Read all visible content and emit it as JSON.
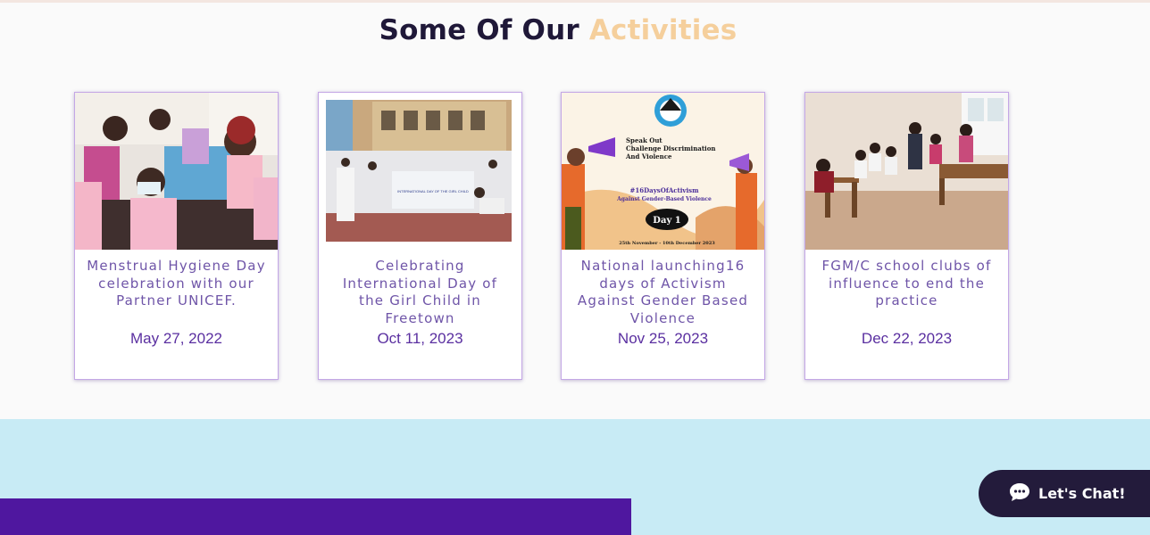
{
  "section": {
    "title_main": "Some Of Our ",
    "title_accent": "Activities"
  },
  "cards": [
    {
      "title": "Menstrual Hygiene Day celebration with our Partner UNICEF.",
      "date": "May 27, 2022",
      "image_alt": "Girls in pink t-shirts seated at an event"
    },
    {
      "title": "Celebrating International Day of the Girl Child  in Freetown",
      "date": "Oct 11, 2023",
      "image_alt": "Group photo with banner in front of building",
      "banner_text": "INTERNATIONAL DAY OF THE GIRL CHILD"
    },
    {
      "title": "National launching16 days of Activism Against Gender Based Violence",
      "date": "Nov 25, 2023",
      "image_alt": "16 Days of Activism poster",
      "poster": {
        "line1": "Speak Out",
        "line2": "Challenge Discrimination",
        "line3": "And Violence",
        "hashtag": "#16DaysOfActivism",
        "subtitle": "Against Gender-Based Violence",
        "day": "Day 1",
        "dates": "25th November - 10th December 2023"
      }
    },
    {
      "title": "FGM/C school clubs of influence to end the practice",
      "date": "Dec 22, 2023",
      "image_alt": "Classroom meeting with students seated"
    }
  ],
  "chat": {
    "label": "Let's Chat!"
  },
  "colors": {
    "title_dark": "#1f1838",
    "title_accent": "#f5cf9c",
    "card_text": "#6f55a8",
    "date_text": "#5a2fa0",
    "band": "#c8ebf5",
    "purple_bar": "#4f179f",
    "chat_bg": "#231b3b"
  }
}
